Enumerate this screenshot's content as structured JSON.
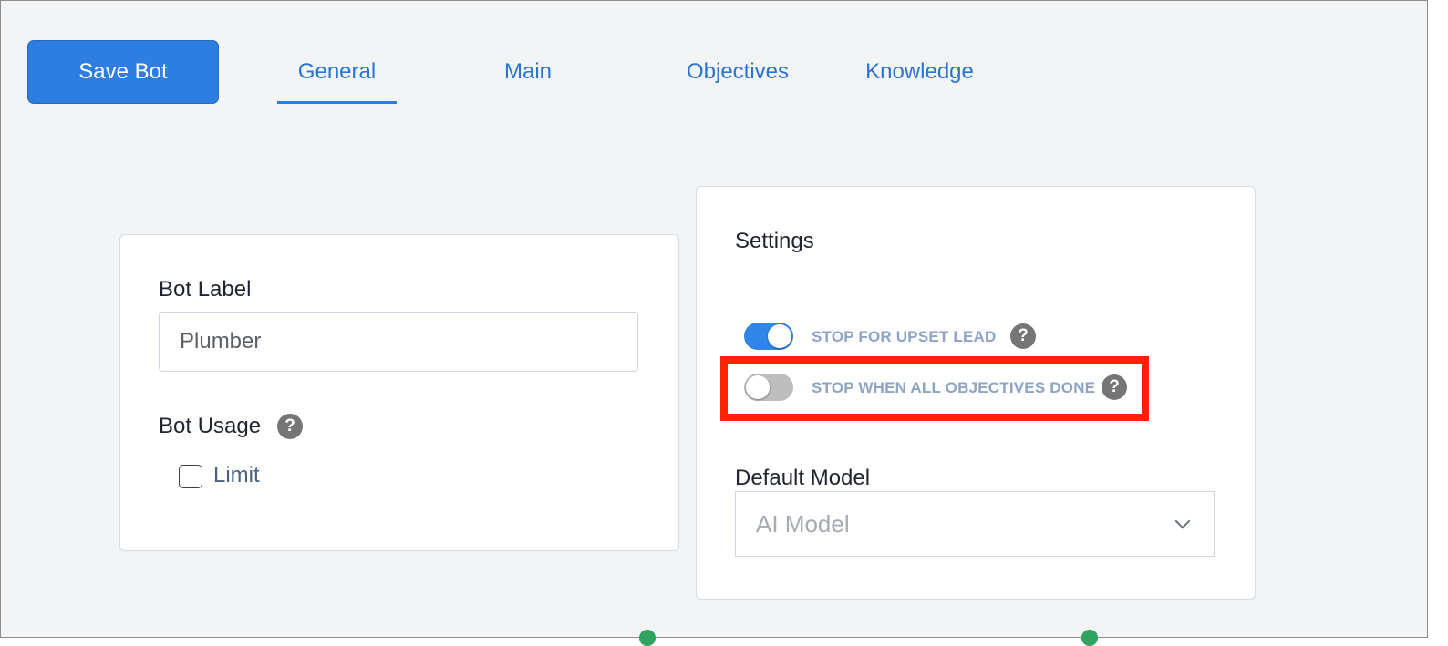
{
  "toolbar": {
    "save_label": "Save Bot"
  },
  "tabs": [
    {
      "label": "General",
      "active": true
    },
    {
      "label": "Main",
      "active": false
    },
    {
      "label": "Objectives",
      "active": false
    },
    {
      "label": "Knowledge",
      "active": false
    }
  ],
  "general_card": {
    "bot_label": {
      "label": "Bot Label",
      "value": "Plumber"
    },
    "bot_usage": {
      "label": "Bot Usage",
      "help": "?",
      "limit_label": "Limit",
      "limit_checked": false
    }
  },
  "settings_card": {
    "title": "Settings",
    "toggles": [
      {
        "label": "STOP FOR UPSET LEAD",
        "on": true,
        "help": "?"
      },
      {
        "label": "STOP WHEN ALL OBJECTIVES DONE",
        "on": false,
        "help": "?"
      }
    ],
    "default_model": {
      "label": "Default Model",
      "value": "AI Model"
    }
  },
  "colors": {
    "accent": "#2e7de1",
    "toggle_on": "#2f86e8",
    "toggle_off": "#bdbdbd",
    "highlight": "#ff2200"
  }
}
